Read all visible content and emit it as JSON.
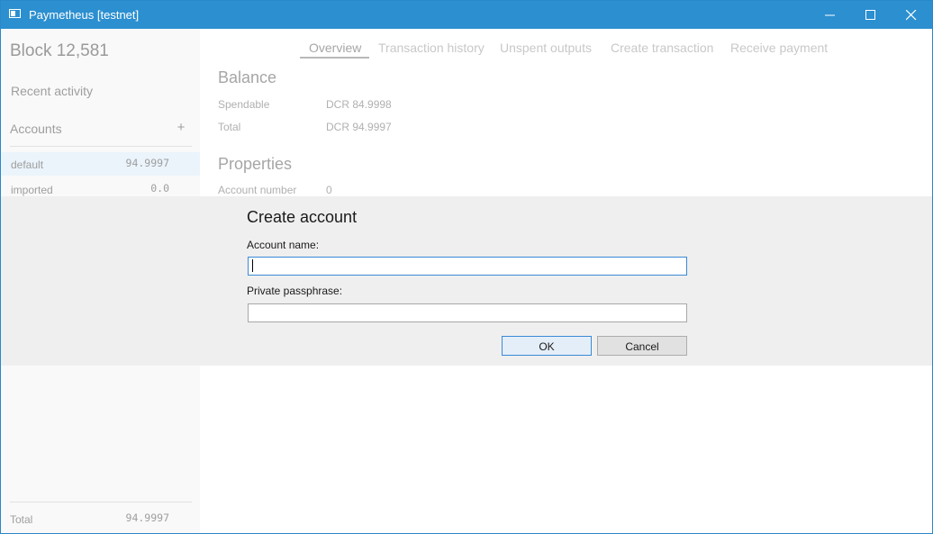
{
  "window": {
    "title": "Paymetheus [testnet]"
  },
  "sidebar": {
    "block": "Block 12,581",
    "recent_activity": "Recent activity",
    "accounts_header": "Accounts",
    "add_account_symbol": "+",
    "accounts": [
      {
        "name": "default",
        "balance": "94.9997",
        "selected": true
      },
      {
        "name": "imported",
        "balance": "0.0",
        "selected": false
      }
    ],
    "total_label": "Total",
    "total_value": "94.9997"
  },
  "tabs": [
    {
      "label": "Overview",
      "active": true
    },
    {
      "label": "Transaction history",
      "active": false
    },
    {
      "label": "Unspent outputs",
      "active": false
    },
    {
      "label": "Create transaction",
      "active": false
    },
    {
      "label": "Receive payment",
      "active": false
    }
  ],
  "main": {
    "balance_title": "Balance",
    "spendable_label": "Spendable",
    "spendable_value": "DCR 84.9998",
    "total_label": "Total",
    "total_value": "DCR 94.9997",
    "properties_title": "Properties",
    "account_number_label": "Account number",
    "account_number_value": "0"
  },
  "dialog": {
    "title": "Create account",
    "account_name_label": "Account name:",
    "account_name_value": "",
    "passphrase_label": "Private passphrase:",
    "passphrase_value": "",
    "ok_label": "OK",
    "cancel_label": "Cancel"
  },
  "colors": {
    "titlebar": "#2b8fd0",
    "accent_focus": "#3a8ad6",
    "selected_row": "#ebf4fb"
  }
}
